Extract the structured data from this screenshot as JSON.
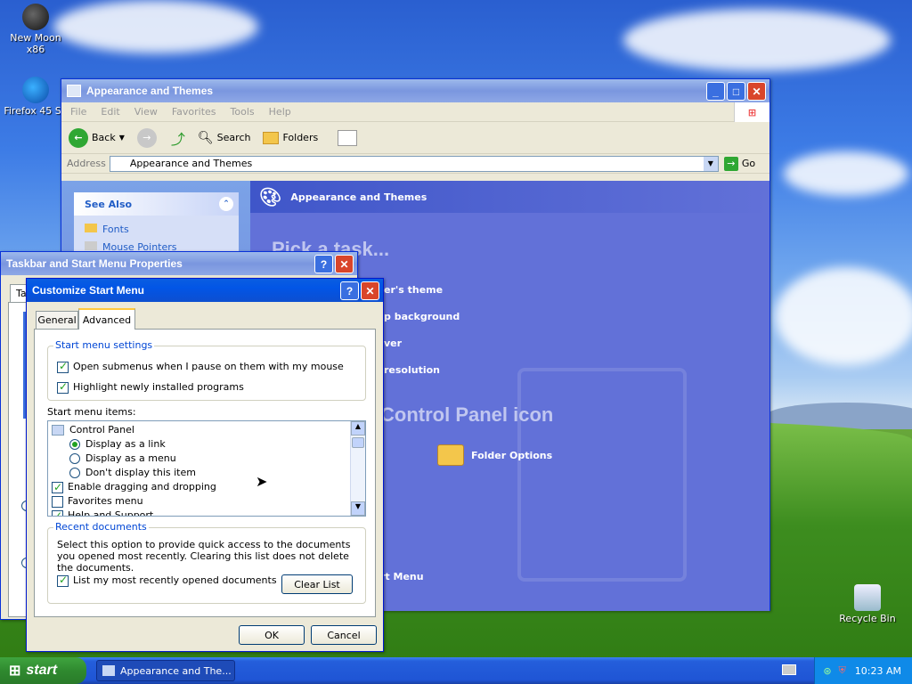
{
  "desktop": {
    "icons": [
      {
        "label": "New Moon x86"
      },
      {
        "label": "Firefox 45 SS"
      },
      {
        "label": "Recycle Bin"
      }
    ]
  },
  "explorer": {
    "title": "Appearance and Themes",
    "menu": [
      "File",
      "Edit",
      "View",
      "Favorites",
      "Tools",
      "Help"
    ],
    "toolbar": {
      "back": "Back",
      "search": "Search",
      "folders": "Folders"
    },
    "address_label": "Address",
    "address_value": "Appearance and Themes",
    "go": "Go",
    "see_also": "See Also",
    "see_also_items": [
      "Fonts",
      "Mouse Pointers"
    ],
    "header": "Appearance and Themes",
    "pick_task": "Pick a task...",
    "tasks": [
      "er's theme",
      "p background",
      "ver",
      "resolution"
    ],
    "pick_icon": "Control Panel icon",
    "folder_options": "Folder Options",
    "start_menu_link": "rt Menu"
  },
  "taskbar_props": {
    "title": "Taskbar and Start Menu Properties",
    "tab_partial": "Ta"
  },
  "customize": {
    "title": "Customize Start Menu",
    "tabs": [
      "General",
      "Advanced"
    ],
    "settings_group": "Start menu settings",
    "settings": [
      {
        "label": "Open submenus when I pause on them with my mouse",
        "checked": true
      },
      {
        "label": "Highlight newly installed programs",
        "checked": true
      }
    ],
    "items_label": "Start menu items:",
    "items": {
      "control_panel": "Control Panel",
      "cp_link": "Display as a link",
      "cp_menu": "Display as a menu",
      "cp_none": "Don't display this item",
      "dragging": "Enable dragging and dropping",
      "favorites": "Favorites menu",
      "help": "Help and Support"
    },
    "recent_group": "Recent documents",
    "recent_desc": "Select this option to provide quick access to the documents you opened most recently.  Clearing this list does not delete the documents.",
    "recent_check": "List my most recently opened documents",
    "clear_list": "Clear List",
    "ok": "OK",
    "cancel": "Cancel"
  },
  "taskbar": {
    "start": "start",
    "task": "Appearance and The...",
    "clock": "10:23 AM"
  }
}
